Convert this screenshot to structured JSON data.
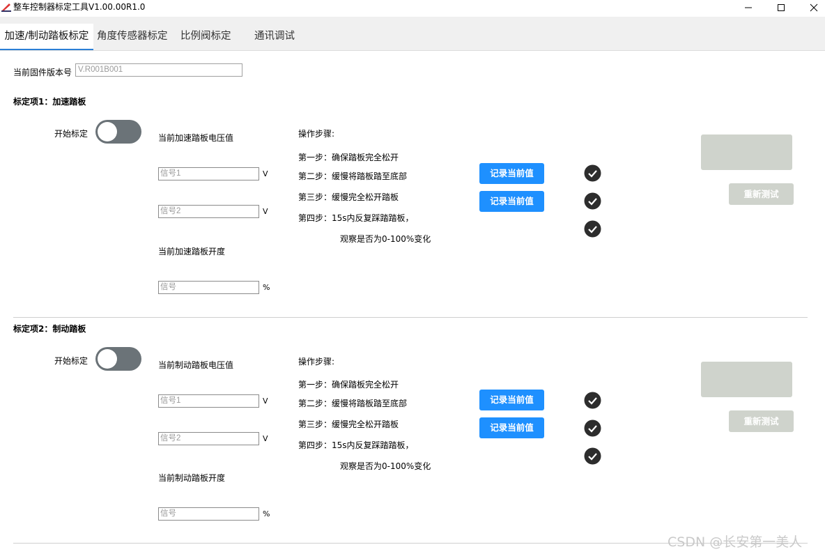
{
  "window": {
    "title": "整车控制器标定工具V1.00.00R1.0",
    "minimize_glyph": "—",
    "maximize_glyph": "☐",
    "close_glyph": "✕"
  },
  "tabs": [
    {
      "label": "加速/制动踏板标定",
      "active": true
    },
    {
      "label": "角度传感器标定",
      "active": false
    },
    {
      "label": "比例阀标定",
      "active": false
    },
    {
      "label": "通讯调试",
      "active": false
    }
  ],
  "firmware": {
    "label": "当前固件版本号",
    "value": "V.R001B001"
  },
  "sections": [
    {
      "title": "标定项1：加速踏板",
      "toggle_label": "开始标定",
      "voltage_label": "当前加速踏板电压值",
      "signal1_placeholder": "信号1",
      "signal2_placeholder": "信号2",
      "unit_v": "V",
      "opening_label": "当前加速踏板开度",
      "signal_placeholder": "信号",
      "unit_percent": "%",
      "steps_title": "操作步骤:",
      "step1": "第一步：确保踏板完全松开",
      "step2": "第二步：缓慢将踏板踏至底部",
      "step3": "第三步：缓慢完全松开踏板",
      "step4": "第四步：15s内反复踩踏踏板，",
      "step4b": "观察是否为0-100%变化",
      "record_btn_1": "记录当前值",
      "record_btn_2": "记录当前值",
      "retest_btn": "重新测试"
    },
    {
      "title": "标定项2：制动踏板",
      "toggle_label": "开始标定",
      "voltage_label": "当前制动踏板电压值",
      "signal1_placeholder": "信号1",
      "signal2_placeholder": "信号2",
      "unit_v": "V",
      "opening_label": "当前制动踏板开度",
      "signal_placeholder": "信号",
      "unit_percent": "%",
      "steps_title": "操作步骤:",
      "step1": "第一步：确保踏板完全松开",
      "step2": "第二步：缓慢将踏板踏至底部",
      "step3": "第三步：缓慢完全松开踏板",
      "step4": "第四步：15s内反复踩踏踏板，",
      "step4b": "观察是否为0-100%变化",
      "record_btn_1": "记录当前值",
      "record_btn_2": "记录当前值",
      "retest_btn": "重新测试"
    }
  ],
  "watermark": "CSDN @长安第一美人",
  "colors": {
    "accent_blue": "#1e90ff",
    "toggle_off": "#6b7378",
    "disabled_gray": "#cfd3cc",
    "check_dark": "#2d2d2d"
  },
  "icons": {
    "app": "pen-ruler-icon",
    "check": "check-circle-icon"
  }
}
